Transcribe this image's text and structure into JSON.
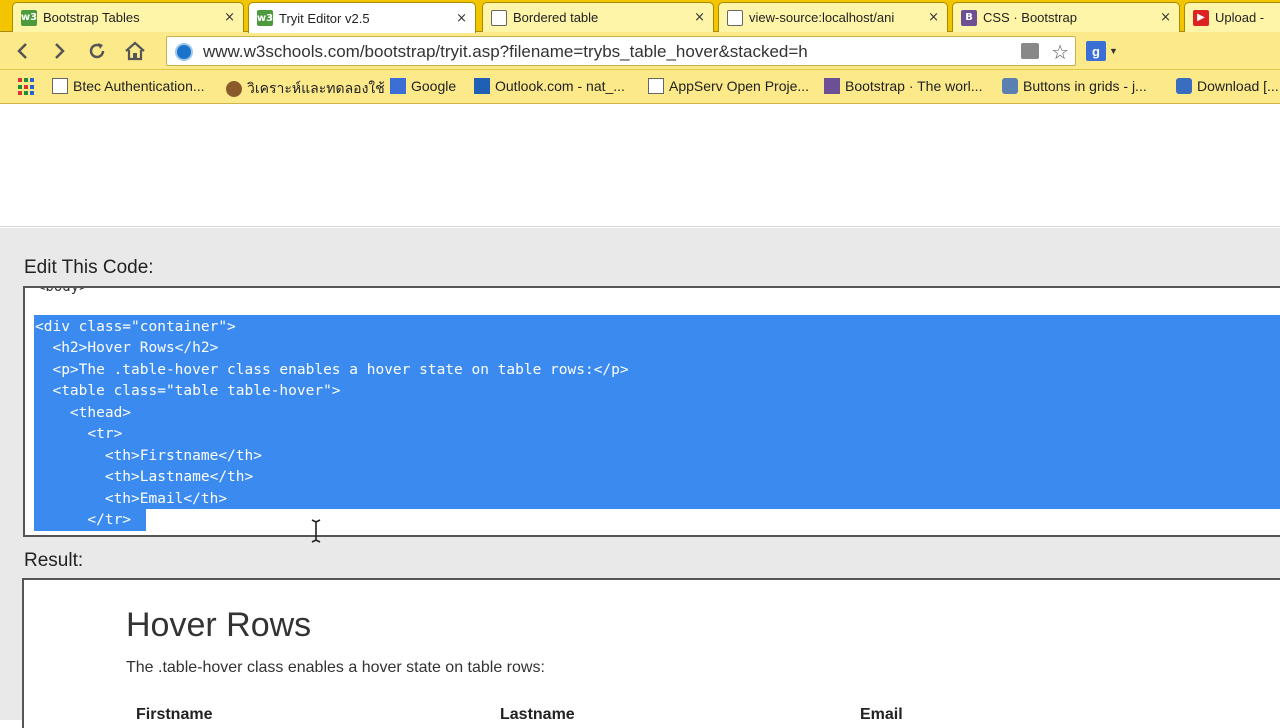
{
  "browser": {
    "tabs": [
      {
        "title": "Bootstrap Tables",
        "favicon": "w3schools-icon",
        "active": false
      },
      {
        "title": "Tryit Editor v2.5",
        "favicon": "w3schools-icon",
        "active": true
      },
      {
        "title": "Bordered table",
        "favicon": "page-icon",
        "active": false
      },
      {
        "title": "view-source:localhost/ani",
        "favicon": "page-icon",
        "active": false
      },
      {
        "title": "CSS · Bootstrap",
        "favicon": "bootstrap-icon",
        "active": false
      },
      {
        "title": "Upload -",
        "favicon": "youtube-icon",
        "active": false
      }
    ],
    "tab_close_glyph": "×",
    "url": "www.w3schools.com/bootstrap/tryit.asp?filename=trybs_table_hover&stacked=h",
    "extension_letter": "g",
    "bookmarks": [
      {
        "label": "Btec Authentication...",
        "icon": "page-icon"
      },
      {
        "label": "วิเคราะห์และทดลองใช้",
        "icon": "site-icon"
      },
      {
        "label": "Google",
        "icon": "google-icon"
      },
      {
        "label": "Outlook.com - nat_...",
        "icon": "outlook-icon"
      },
      {
        "label": "AppServ Open Proje...",
        "icon": "page-icon"
      },
      {
        "label": "Bootstrap · The worl...",
        "icon": "bootstrap-icon"
      },
      {
        "label": "Buttons in grids - j...",
        "icon": "stack-icon"
      },
      {
        "label": "Download [...",
        "icon": "download-icon"
      }
    ]
  },
  "editor": {
    "heading": "Edit This Code:",
    "cutoff_line": "<body>",
    "lines": [
      "<div class=\"container\">",
      "  <h2>Hover Rows</h2>",
      "  <p>The .table-hover class enables a hover state on table rows:</p>",
      "  <table class=\"table table-hover\">",
      "    <thead>",
      "      <tr>",
      "        <th>Firstname</th>",
      "        <th>Lastname</th>",
      "        <th>Email</th>",
      "      </tr>"
    ]
  },
  "result": {
    "heading": "Result:",
    "title": "Hover Rows",
    "description": "The .table-hover class enables a hover state on table rows:",
    "columns": [
      "Firstname",
      "Lastname",
      "Email"
    ]
  },
  "colors": {
    "tabstrip": "#f2c500",
    "toolbar": "#fbe98a",
    "selection": "#3a8af0"
  }
}
